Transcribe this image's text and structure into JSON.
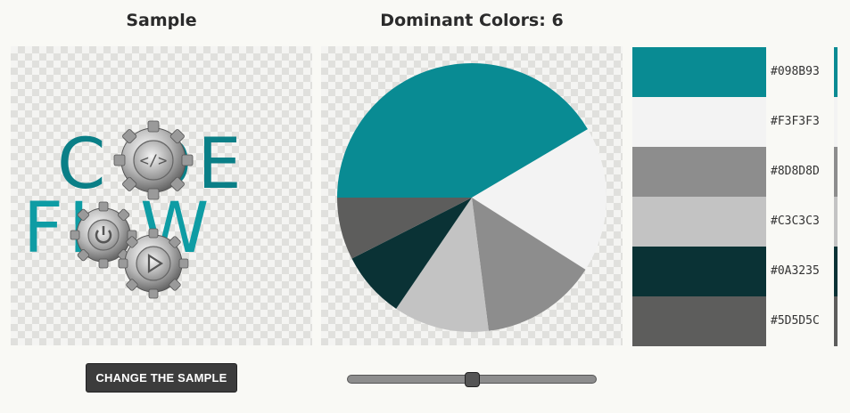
{
  "headings": {
    "sample": "Sample",
    "dominant_colors": "Dominant Colors: 6"
  },
  "sample_image": {
    "logo_top_word": "C DE",
    "logo_bottom_word": "FL W",
    "logo_primary_color": "#0A7F87",
    "logo_secondary_color": "#0E9CA4",
    "gear_icons": [
      "code-brackets-icon",
      "power-icon",
      "play-icon"
    ]
  },
  "palette": [
    {
      "hex": "#098B93",
      "label": "#098B93"
    },
    {
      "hex": "#F3F3F3",
      "label": "#F3F3F3"
    },
    {
      "hex": "#8D8D8D",
      "label": "#8D8D8D"
    },
    {
      "hex": "#C3C3C3",
      "label": "#C3C3C3"
    },
    {
      "hex": "#0A3235",
      "label": "#0A3235"
    },
    {
      "hex": "#5D5D5C",
      "label": "#5D5D5C"
    }
  ],
  "chart_data": {
    "type": "pie",
    "title": "",
    "slices": [
      {
        "label": "#098B93",
        "color": "#098B93",
        "value": 41.5
      },
      {
        "label": "#F3F3F3",
        "color": "#F3F3F3",
        "value": 17.5
      },
      {
        "label": "#8D8D8D",
        "color": "#8D8D8D",
        "value": 14.0
      },
      {
        "label": "#C3C3C3",
        "color": "#C3C3C3",
        "value": 11.5
      },
      {
        "label": "#0A3235",
        "color": "#0A3235",
        "value": 8.0
      },
      {
        "label": "#5D5D5C",
        "color": "#5D5D5C",
        "value": 7.5
      }
    ],
    "start_angle_deg": 180,
    "direction": "clockwise"
  },
  "buttons": {
    "change_sample": "CHANGE THE SAMPLE"
  },
  "slider": {
    "value_fraction": 0.5
  }
}
